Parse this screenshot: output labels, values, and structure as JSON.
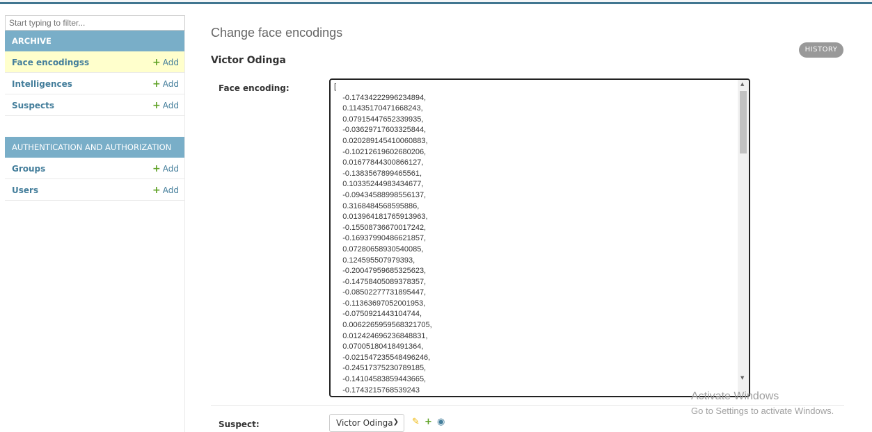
{
  "sidebar": {
    "filter_placeholder": "Start typing to filter...",
    "modules": [
      {
        "caption": "ARCHIVE",
        "models": [
          {
            "name": "Face encodingss",
            "add": "Add"
          },
          {
            "name": "Intelligences",
            "add": "Add"
          },
          {
            "name": "Suspects",
            "add": "Add"
          }
        ]
      },
      {
        "caption": "AUTHENTICATION AND AUTHORIZATION",
        "models": [
          {
            "name": "Groups",
            "add": "Add"
          },
          {
            "name": "Users",
            "add": "Add"
          }
        ]
      }
    ]
  },
  "main": {
    "title": "Change face encodings",
    "history_label": "HISTORY",
    "object_name": "Victor Odinga",
    "fields": {
      "face_encoding_label": "Face encoding:",
      "face_encoding_value": "[\n    -0.17434222996234894,\n    0.11435170471668243,\n    0.07915447652339935,\n    -0.03629717603325844,\n    0.020289145410060883,\n    -0.10212619602680206,\n    0.01677844300866127,\n    -0.1383567899465561,\n    0.10335244983434677,\n    -0.09434588998556137,\n    0.3168484568595886,\n    0.013964181765913963,\n    -0.15508736670017242,\n    -0.16937990486621857,\n    0.07280658930540085,\n    0.124595507979393,\n    -0.20047959685325623,\n    -0.14758405089378357,\n    -0.08502277731895447,\n    -0.11363697052001953,\n    -0.0750921443104744,\n    0.0062265959568321705,\n    0.012424696236848831,\n    0.07005180418491364,\n    -0.021547235548496246,\n    -0.24517375230789185,\n    -0.14104583859443665,\n    -0.1743215768539243",
      "suspect_label": "Suspect:",
      "suspect_selected": "Victor Odinga"
    }
  },
  "watermark": {
    "title": "Activate Windows",
    "subtitle": "Go to Settings to activate Windows."
  },
  "colors": {
    "header_bar": "#417690",
    "module_caption": "#79aec8",
    "link": "#447e9b",
    "add_green": "#5fa225",
    "active_row": "#ffffcc",
    "history_button": "#999999"
  },
  "icons": {
    "add": "plus-icon",
    "edit": "pencil-icon",
    "view": "eye-icon",
    "select": "chevron-down-icon"
  }
}
